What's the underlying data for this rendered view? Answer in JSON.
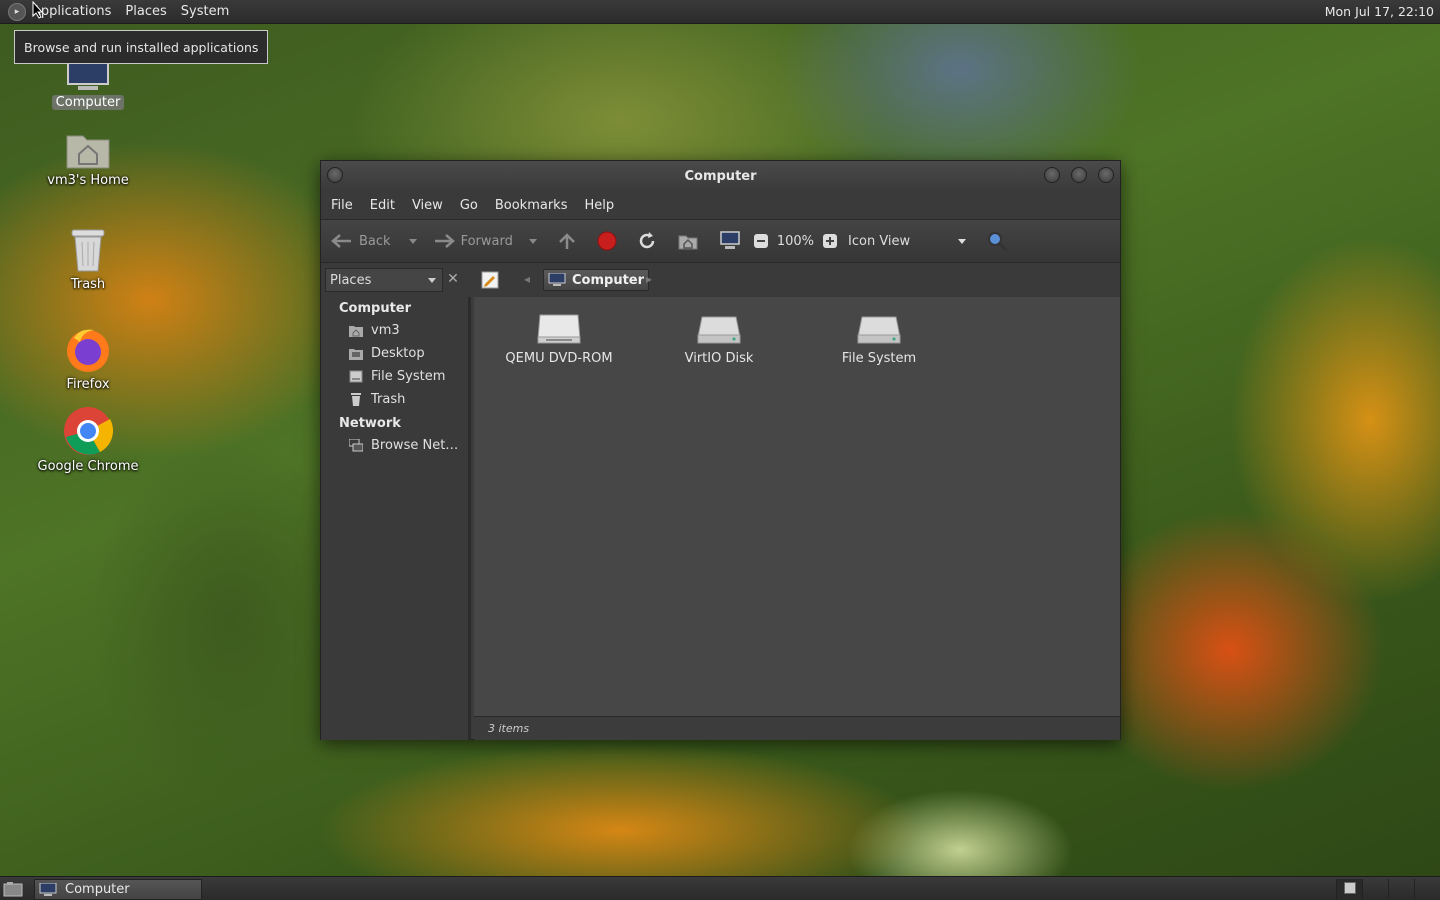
{
  "top_panel": {
    "menus": [
      "Applications",
      "Places",
      "System"
    ],
    "clock": "Mon Jul 17, 22:10"
  },
  "tooltip": "Browse and run installed applications",
  "desktop_icons": [
    {
      "label": "Computer",
      "icon": "computer-icon"
    },
    {
      "label": "vm3's Home",
      "icon": "home-folder-icon"
    },
    {
      "label": "Trash",
      "icon": "trash-icon"
    },
    {
      "label": "Firefox",
      "icon": "firefox-icon"
    },
    {
      "label": "Google Chrome",
      "icon": "chrome-icon"
    }
  ],
  "window": {
    "title": "Computer",
    "menus": [
      "File",
      "Edit",
      "View",
      "Go",
      "Bookmarks",
      "Help"
    ],
    "toolbar": {
      "back": "Back",
      "forward": "Forward",
      "zoom": "100%",
      "view_mode": "Icon View"
    },
    "location": {
      "places_label": "Places",
      "crumb": "Computer"
    },
    "sidebar": {
      "sections": [
        {
          "title": "Computer",
          "items": [
            "vm3",
            "Desktop",
            "File System",
            "Trash"
          ]
        },
        {
          "title": "Network",
          "items": [
            "Browse Net…"
          ]
        }
      ]
    },
    "files": [
      {
        "label": "QEMU DVD-ROM",
        "icon": "optical-drive-icon"
      },
      {
        "label": "VirtIO Disk",
        "icon": "hard-disk-icon"
      },
      {
        "label": "File System",
        "icon": "hard-disk-icon"
      }
    ],
    "status": "3 items"
  },
  "bottom_panel": {
    "task": "Computer"
  },
  "colors": {
    "panel": "#2f2f2f",
    "window_bg": "#3c3c3c",
    "content_bg": "#474747",
    "stop_red": "#c81e1e"
  }
}
